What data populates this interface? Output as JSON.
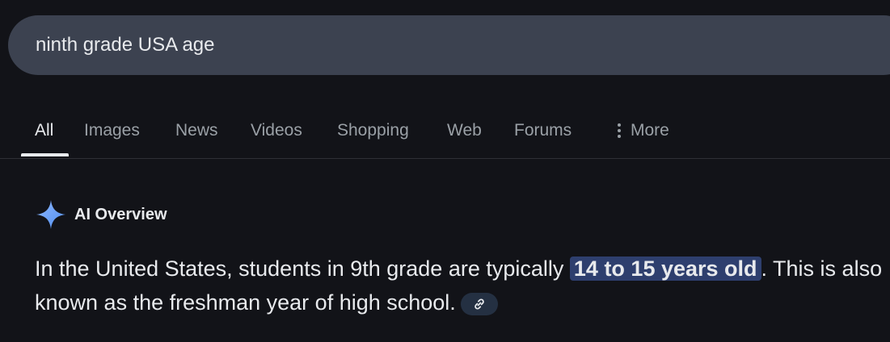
{
  "search": {
    "query": "ninth grade USA age"
  },
  "tabs": [
    {
      "label": "All",
      "active": true
    },
    {
      "label": "Images"
    },
    {
      "label": "News"
    },
    {
      "label": "Videos"
    },
    {
      "label": "Shopping"
    },
    {
      "label": "Web"
    },
    {
      "label": "Forums"
    },
    {
      "label": "More",
      "icon": "more-vert-icon"
    }
  ],
  "ai_overview": {
    "title": "AI Overview",
    "icon": "sparkle-icon",
    "text_before": "In the United States, students in 9th grade are typically",
    "highlight": "14 to 15 years old",
    "text_after": ". This is also known as the freshman year of high school.",
    "link_icon": "link-icon"
  },
  "colors": {
    "background": "#121318",
    "search_bar": "#3c4250",
    "highlight": "#2e3f6e",
    "sparkle": "#6ba3f5"
  }
}
